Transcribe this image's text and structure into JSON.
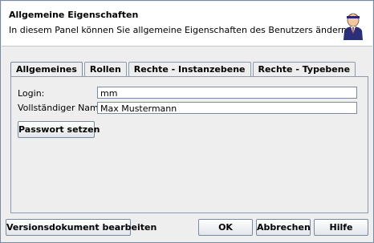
{
  "header": {
    "title": "Allgemeine Eigenschaften",
    "subtitle": "In diesem Panel können Sie allgemeine Eigenschaften des Benutzers ändern.",
    "icon": "user-icon"
  },
  "tabs": [
    {
      "label": "Allgemeines",
      "active": true
    },
    {
      "label": "Rollen",
      "active": false
    },
    {
      "label": "Rechte - Instanzebene",
      "active": false
    },
    {
      "label": "Rechte - Typebene",
      "active": false
    }
  ],
  "form": {
    "login_label": "Login:",
    "login_value": "mm",
    "fullname_label": "Vollständiger Name:",
    "fullname_value": "Max Mustermann",
    "password_button": "Passwort setzen"
  },
  "footer": {
    "version_button": "Versionsdokument bearbeiten",
    "ok_button": "OK",
    "cancel_button": "Abbrechen",
    "help_button": "Hilfe"
  },
  "colors": {
    "border": "#7a8aa0",
    "panel_bg": "#eeeeee",
    "header_bg": "#ffffff"
  }
}
